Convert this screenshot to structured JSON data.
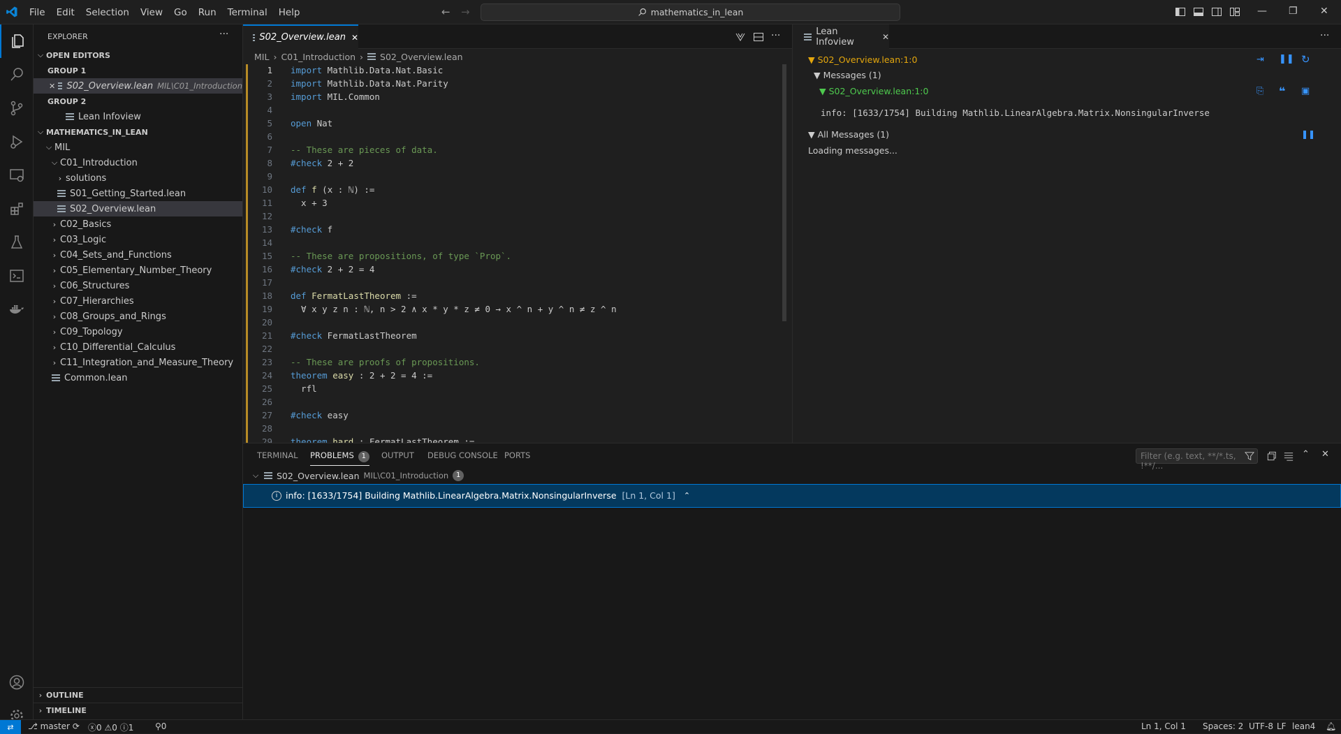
{
  "menu": [
    "File",
    "Edit",
    "Selection",
    "View",
    "Go",
    "Run",
    "Terminal",
    "Help"
  ],
  "search": {
    "text": "mathematics_in_lean"
  },
  "sidebar": {
    "title": "EXPLORER",
    "open_editors": "OPEN EDITORS",
    "group1": "GROUP 1",
    "group1_file": "S02_Overview.lean",
    "group1_desc": "MIL\\C01_Introduction",
    "group2": "GROUP 2",
    "group2_file": "Lean Infoview",
    "workspace": "MATHEMATICS_IN_LEAN",
    "mil": "MIL",
    "c01": "C01_Introduction",
    "solutions": "solutions",
    "s01": "S01_Getting_Started.lean",
    "s02": "S02_Overview.lean",
    "chapters": [
      "C02_Basics",
      "C03_Logic",
      "C04_Sets_and_Functions",
      "C05_Elementary_Number_Theory",
      "C06_Structures",
      "C07_Hierarchies",
      "C08_Groups_and_Rings",
      "C09_Topology",
      "C10_Differential_Calculus",
      "C11_Integration_and_Measure_Theory"
    ],
    "common": "Common.lean",
    "outline": "OUTLINE",
    "timeline": "TIMELINE"
  },
  "editor": {
    "tab": "S02_Overview.lean",
    "breadcrumb": [
      "MIL",
      "C01_Introduction",
      "S02_Overview.lean"
    ],
    "lines": [
      "import Mathlib.Data.Nat.Basic",
      "import Mathlib.Data.Nat.Parity",
      "import MIL.Common",
      "",
      "open Nat",
      "",
      "-- These are pieces of data.",
      "#check 2 + 2",
      "",
      "def f (x : ℕ) :=",
      "  x + 3",
      "",
      "#check f",
      "",
      "-- These are propositions, of type `Prop`.",
      "#check 2 + 2 = 4",
      "",
      "def FermatLastTheorem :=",
      "  ∀ x y z n : ℕ, n > 2 ∧ x * y * z ≠ 0 → x ^ n + y ^ n ≠ z ^ n",
      "",
      "#check FermatLastTheorem",
      "",
      "-- These are proofs of propositions.",
      "theorem easy : 2 + 2 = 4 :=",
      "  rfl",
      "",
      "#check easy",
      "",
      "theorem hard : FermatLastTheorem :="
    ]
  },
  "infoview": {
    "tab": "Lean Infoview",
    "pos": "S02_Overview.lean:1:0",
    "messages": "Messages (1)",
    "msg_pos": "S02_Overview.lean:1:0",
    "info": "info: [1633/1754] Building Mathlib.LinearAlgebra.Matrix.NonsingularInverse",
    "all_messages": "All Messages (1)",
    "loading": "Loading messages..."
  },
  "panel": {
    "tabs": [
      "TERMINAL",
      "PROBLEMS",
      "OUTPUT",
      "DEBUG CONSOLE",
      "PORTS"
    ],
    "problems_count": "1",
    "filter_placeholder": "Filter (e.g. text, **/*.ts, !**/...",
    "file": "S02_Overview.lean",
    "file_desc": "MIL\\C01_Introduction",
    "file_count": "1",
    "problem": "info: [1633/1754] Building Mathlib.LinearAlgebra.Matrix.NonsingularInverse",
    "problem_loc": "[Ln 1, Col 1]"
  },
  "status": {
    "branch": "master",
    "errors": "0",
    "warnings": "0",
    "infos": "1",
    "ports": "0",
    "position": "Ln 1, Col 1",
    "spaces": "Spaces: 2",
    "encoding": "UTF-8",
    "eol": "LF",
    "language": "lean4"
  },
  "colors": {
    "accent": "#0078d4",
    "modified": "#b78b26",
    "lean_orange": "#e3a60d",
    "lean_green": "#4ec94e"
  }
}
